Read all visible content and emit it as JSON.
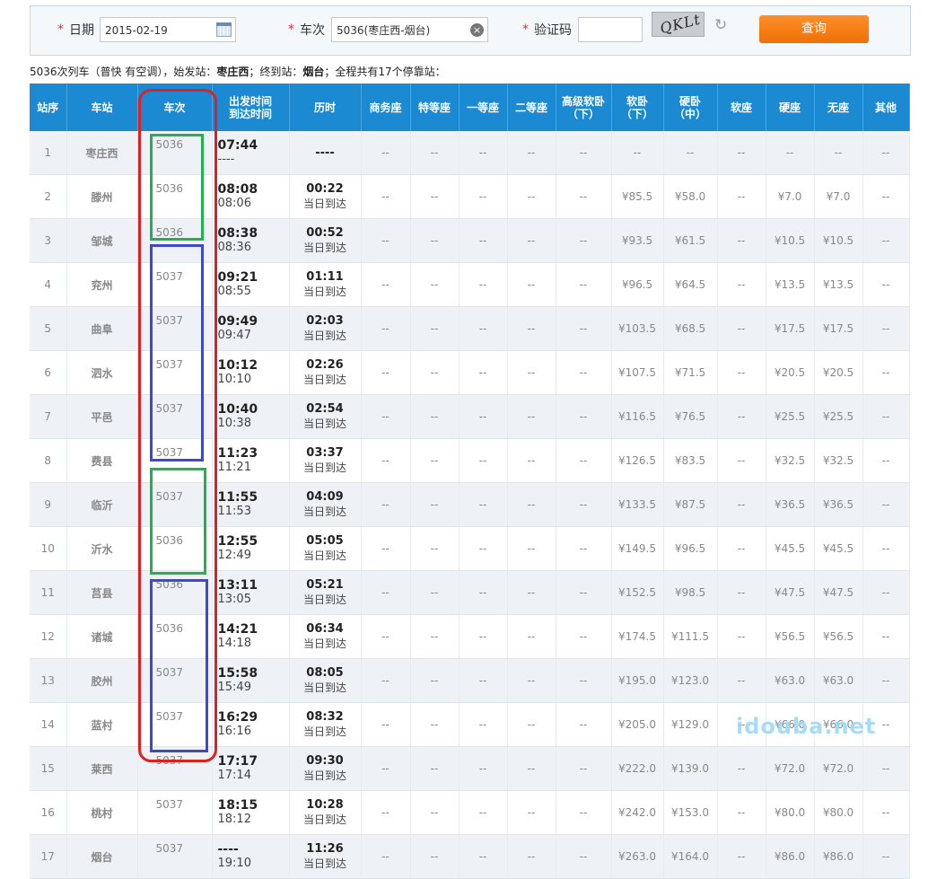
{
  "search": {
    "date_label": "日期",
    "date_value": "2015-02-19",
    "train_label": "车次",
    "train_value": "5036(枣庄西-烟台)",
    "captcha_label": "验证码",
    "captcha_value": "",
    "captcha_text": "QKLt",
    "query_label": "查询"
  },
  "summary": {
    "train": "5036次列车（普快 有空调），始发站：",
    "origin": "枣庄西",
    "mid": "；终到站：",
    "terminal": "烟台",
    "tail": "；全程共有17个停靠站："
  },
  "table": {
    "headers": [
      {
        "line1": "站序",
        "line2": ""
      },
      {
        "line1": "车站",
        "line2": ""
      },
      {
        "line1": "车次",
        "line2": ""
      },
      {
        "line1": "出发时间",
        "line2": "到达时间"
      },
      {
        "line1": "历时",
        "line2": ""
      },
      {
        "line1": "商务座",
        "line2": ""
      },
      {
        "line1": "特等座",
        "line2": ""
      },
      {
        "line1": "一等座",
        "line2": ""
      },
      {
        "line1": "二等座",
        "line2": ""
      },
      {
        "line1": "高级软卧",
        "line2": "（下）"
      },
      {
        "line1": "软卧",
        "line2": "（下）"
      },
      {
        "line1": "硬卧",
        "line2": "（中）"
      },
      {
        "line1": "软座",
        "line2": ""
      },
      {
        "line1": "硬座",
        "line2": ""
      },
      {
        "line1": "无座",
        "line2": ""
      },
      {
        "line1": "其他",
        "line2": ""
      }
    ],
    "rows": [
      {
        "seq": "1",
        "station": "枣庄西",
        "train": "5036",
        "dep": "07:44",
        "arr": "----",
        "dur1": "----",
        "dur2": "",
        "swz": "--",
        "tdz": "--",
        "ydz": "--",
        "edz": "--",
        "gjrw": "--",
        "rw": "--",
        "yw": "--",
        "rz": "--",
        "yz": "--",
        "wz": "--",
        "qt": "--"
      },
      {
        "seq": "2",
        "station": "滕州",
        "train": "5036",
        "dep": "08:08",
        "arr": "08:06",
        "dur1": "00:22",
        "dur2": "当日到达",
        "swz": "--",
        "tdz": "--",
        "ydz": "--",
        "edz": "--",
        "gjrw": "--",
        "rw": "¥85.5",
        "yw": "¥58.0",
        "rz": "--",
        "yz": "¥7.0",
        "wz": "¥7.0",
        "qt": "--"
      },
      {
        "seq": "3",
        "station": "邹城",
        "train": "5036",
        "dep": "08:38",
        "arr": "08:36",
        "dur1": "00:52",
        "dur2": "当日到达",
        "swz": "--",
        "tdz": "--",
        "ydz": "--",
        "edz": "--",
        "gjrw": "--",
        "rw": "¥93.5",
        "yw": "¥61.5",
        "rz": "--",
        "yz": "¥10.5",
        "wz": "¥10.5",
        "qt": "--"
      },
      {
        "seq": "4",
        "station": "兖州",
        "train": "5037",
        "dep": "09:21",
        "arr": "08:55",
        "dur1": "01:11",
        "dur2": "当日到达",
        "swz": "--",
        "tdz": "--",
        "ydz": "--",
        "edz": "--",
        "gjrw": "--",
        "rw": "¥96.5",
        "yw": "¥64.5",
        "rz": "--",
        "yz": "¥13.5",
        "wz": "¥13.5",
        "qt": "--"
      },
      {
        "seq": "5",
        "station": "曲阜",
        "train": "5037",
        "dep": "09:49",
        "arr": "09:47",
        "dur1": "02:03",
        "dur2": "当日到达",
        "swz": "--",
        "tdz": "--",
        "ydz": "--",
        "edz": "--",
        "gjrw": "--",
        "rw": "¥103.5",
        "yw": "¥68.5",
        "rz": "--",
        "yz": "¥17.5",
        "wz": "¥17.5",
        "qt": "--"
      },
      {
        "seq": "6",
        "station": "泗水",
        "train": "5037",
        "dep": "10:12",
        "arr": "10:10",
        "dur1": "02:26",
        "dur2": "当日到达",
        "swz": "--",
        "tdz": "--",
        "ydz": "--",
        "edz": "--",
        "gjrw": "--",
        "rw": "¥107.5",
        "yw": "¥71.5",
        "rz": "--",
        "yz": "¥20.5",
        "wz": "¥20.5",
        "qt": "--"
      },
      {
        "seq": "7",
        "station": "平邑",
        "train": "5037",
        "dep": "10:40",
        "arr": "10:38",
        "dur1": "02:54",
        "dur2": "当日到达",
        "swz": "--",
        "tdz": "--",
        "ydz": "--",
        "edz": "--",
        "gjrw": "--",
        "rw": "¥116.5",
        "yw": "¥76.5",
        "rz": "--",
        "yz": "¥25.5",
        "wz": "¥25.5",
        "qt": "--"
      },
      {
        "seq": "8",
        "station": "费县",
        "train": "5037",
        "dep": "11:23",
        "arr": "11:21",
        "dur1": "03:37",
        "dur2": "当日到达",
        "swz": "--",
        "tdz": "--",
        "ydz": "--",
        "edz": "--",
        "gjrw": "--",
        "rw": "¥126.5",
        "yw": "¥83.5",
        "rz": "--",
        "yz": "¥32.5",
        "wz": "¥32.5",
        "qt": "--"
      },
      {
        "seq": "9",
        "station": "临沂",
        "train": "5037",
        "dep": "11:55",
        "arr": "11:53",
        "dur1": "04:09",
        "dur2": "当日到达",
        "swz": "--",
        "tdz": "--",
        "ydz": "--",
        "edz": "--",
        "gjrw": "--",
        "rw": "¥133.5",
        "yw": "¥87.5",
        "rz": "--",
        "yz": "¥36.5",
        "wz": "¥36.5",
        "qt": "--"
      },
      {
        "seq": "10",
        "station": "沂水",
        "train": "5036",
        "dep": "12:55",
        "arr": "12:49",
        "dur1": "05:05",
        "dur2": "当日到达",
        "swz": "--",
        "tdz": "--",
        "ydz": "--",
        "edz": "--",
        "gjrw": "--",
        "rw": "¥149.5",
        "yw": "¥96.5",
        "rz": "--",
        "yz": "¥45.5",
        "wz": "¥45.5",
        "qt": "--"
      },
      {
        "seq": "11",
        "station": "莒县",
        "train": "5036",
        "dep": "13:11",
        "arr": "13:05",
        "dur1": "05:21",
        "dur2": "当日到达",
        "swz": "--",
        "tdz": "--",
        "ydz": "--",
        "edz": "--",
        "gjrw": "--",
        "rw": "¥152.5",
        "yw": "¥98.5",
        "rz": "--",
        "yz": "¥47.5",
        "wz": "¥47.5",
        "qt": "--"
      },
      {
        "seq": "12",
        "station": "诸城",
        "train": "5036",
        "dep": "14:21",
        "arr": "14:18",
        "dur1": "06:34",
        "dur2": "当日到达",
        "swz": "--",
        "tdz": "--",
        "ydz": "--",
        "edz": "--",
        "gjrw": "--",
        "rw": "¥174.5",
        "yw": "¥111.5",
        "rz": "--",
        "yz": "¥56.5",
        "wz": "¥56.5",
        "qt": "--"
      },
      {
        "seq": "13",
        "station": "胶州",
        "train": "5037",
        "dep": "15:58",
        "arr": "15:49",
        "dur1": "08:05",
        "dur2": "当日到达",
        "swz": "--",
        "tdz": "--",
        "ydz": "--",
        "edz": "--",
        "gjrw": "--",
        "rw": "¥195.0",
        "yw": "¥123.0",
        "rz": "--",
        "yz": "¥63.0",
        "wz": "¥63.0",
        "qt": "--"
      },
      {
        "seq": "14",
        "station": "蓝村",
        "train": "5037",
        "dep": "16:29",
        "arr": "16:16",
        "dur1": "08:32",
        "dur2": "当日到达",
        "swz": "--",
        "tdz": "--",
        "ydz": "--",
        "edz": "--",
        "gjrw": "--",
        "rw": "¥205.0",
        "yw": "¥129.0",
        "rz": "--",
        "yz": "¥66.0",
        "wz": "¥66.0",
        "qt": "--"
      },
      {
        "seq": "15",
        "station": "莱西",
        "train": "5037",
        "dep": "17:17",
        "arr": "17:14",
        "dur1": "09:30",
        "dur2": "当日到达",
        "swz": "--",
        "tdz": "--",
        "ydz": "--",
        "edz": "--",
        "gjrw": "--",
        "rw": "¥222.0",
        "yw": "¥139.0",
        "rz": "--",
        "yz": "¥72.0",
        "wz": "¥72.0",
        "qt": "--"
      },
      {
        "seq": "16",
        "station": "桃村",
        "train": "5037",
        "dep": "18:15",
        "arr": "18:12",
        "dur1": "10:28",
        "dur2": "当日到达",
        "swz": "--",
        "tdz": "--",
        "ydz": "--",
        "edz": "--",
        "gjrw": "--",
        "rw": "¥242.0",
        "yw": "¥153.0",
        "rz": "--",
        "yz": "¥80.0",
        "wz": "¥80.0",
        "qt": "--"
      },
      {
        "seq": "17",
        "station": "烟台",
        "train": "5037",
        "dep": "----",
        "arr": "19:10",
        "dur1": "11:26",
        "dur2": "当日到达",
        "swz": "--",
        "tdz": "--",
        "ydz": "--",
        "edz": "--",
        "gjrw": "--",
        "rw": "¥263.0",
        "yw": "¥164.0",
        "rz": "--",
        "yz": "¥86.0",
        "wz": "¥86.0",
        "qt": "--"
      }
    ]
  },
  "annotations": {
    "red": "#e02020",
    "green": "#22b14c",
    "blue": "#3f48cc"
  },
  "watermark": "idouba.net"
}
